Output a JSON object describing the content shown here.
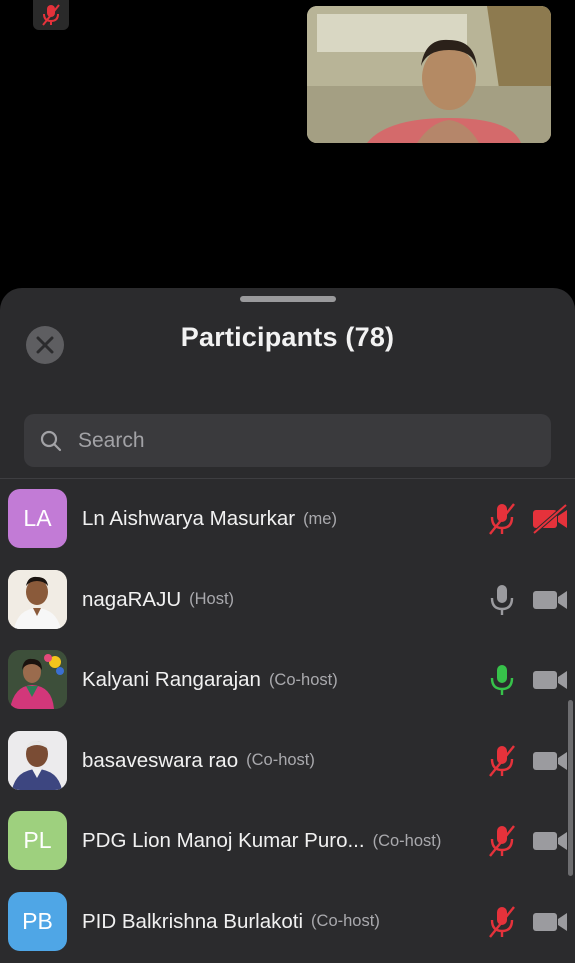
{
  "sheet": {
    "title": "Participants (78)",
    "search_placeholder": "Search"
  },
  "participants": [
    {
      "name": "Ln Aishwarya Masurkar",
      "role": "(me)",
      "initials": "LA",
      "avatar_color": "#c27bd6",
      "mic": "muted",
      "camera": "off"
    },
    {
      "name": "nagaRAJU",
      "role": "(Host)",
      "initials": "",
      "avatar_color": "",
      "mic": "on",
      "camera": "on"
    },
    {
      "name": "Kalyani Rangarajan",
      "role": "(Co-host)",
      "initials": "",
      "avatar_color": "",
      "mic": "speaking",
      "camera": "on"
    },
    {
      "name": "basaveswara rao",
      "role": "(Co-host)",
      "initials": "",
      "avatar_color": "",
      "mic": "muted",
      "camera": "on"
    },
    {
      "name": "PDG Lion Manoj Kumar Puro...",
      "role": "(Co-host)",
      "initials": "PL",
      "avatar_color": "#9ed07e",
      "mic": "muted",
      "camera": "on"
    },
    {
      "name": "PID Balkrishna Burlakoti",
      "role": "(Co-host)",
      "initials": "PB",
      "avatar_color": "#4fa6e6",
      "mic": "muted",
      "camera": "on"
    }
  ],
  "colors": {
    "muted_red": "#e5323b",
    "speaking_green": "#37c24a",
    "icon_gray": "#9b9b9f"
  },
  "icons": {
    "close": "close-icon",
    "search": "search-icon",
    "mic_muted": "mic-muted-icon",
    "mic_on": "mic-icon",
    "camera": "video-camera-icon",
    "camera_off": "video-camera-off-icon"
  }
}
